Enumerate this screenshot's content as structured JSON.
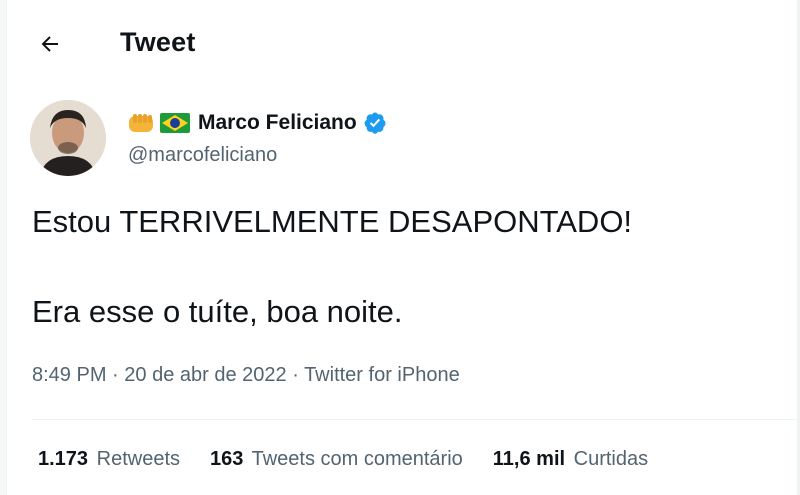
{
  "header": {
    "title": "Tweet",
    "back_icon": "arrow-left-icon"
  },
  "author": {
    "display_name": "Marco Feliciano",
    "handle": "@marcofeliciano",
    "name_emojis": [
      "fist-emoji",
      "brazil-flag-emoji"
    ],
    "verified": true,
    "verified_color": "#1d9bf0"
  },
  "tweet": {
    "line1": "Estou TERRIVELMENTE DESAPONTADO!",
    "line2": "Era esse o tuíte, boa noite."
  },
  "meta": {
    "time": "8:49 PM",
    "separator": " · ",
    "date": "20 de abr de 2022",
    "source": "Twitter for iPhone"
  },
  "stats": {
    "retweets_count": "1.173",
    "retweets_label": "Retweets",
    "quotes_count": "163",
    "quotes_label": "Tweets com comentário",
    "likes_count": "11,6 mil",
    "likes_label": "Curtidas"
  },
  "colors": {
    "text_primary": "#0f1419",
    "text_secondary": "#536471",
    "divider": "#eff3f4"
  }
}
